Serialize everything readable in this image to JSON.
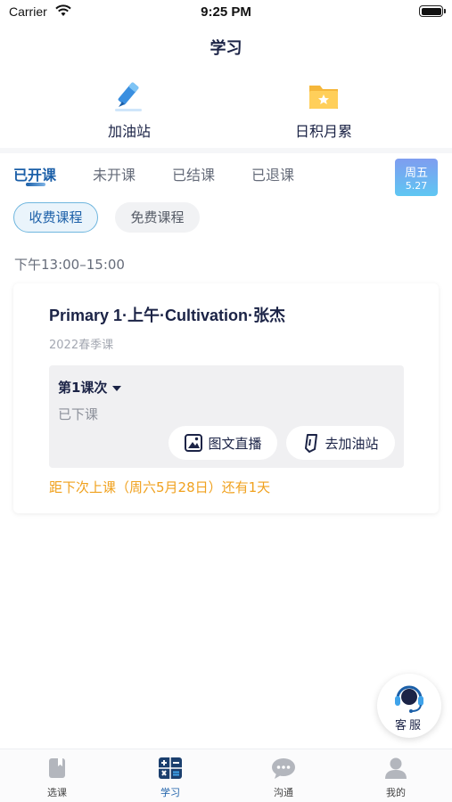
{
  "status_bar": {
    "carrier": "Carrier",
    "time": "9:25 PM"
  },
  "header": {
    "title": "学习"
  },
  "shortcuts": [
    {
      "label": "加油站",
      "icon": "pencil-icon"
    },
    {
      "label": "日积月累",
      "icon": "folder-star-icon"
    }
  ],
  "tabs": [
    {
      "label": "已开课",
      "active": true
    },
    {
      "label": "未开课",
      "active": false
    },
    {
      "label": "已结课",
      "active": false
    },
    {
      "label": "已退课",
      "active": false
    }
  ],
  "date_badge": {
    "weekday": "周五",
    "date": "5.27"
  },
  "filters": [
    {
      "label": "收费课程",
      "selected": true
    },
    {
      "label": "免费课程",
      "selected": false
    }
  ],
  "time_slot": "下午13:00–15:00",
  "course": {
    "title": "Primary 1·上午·Cultivation·张杰",
    "term": "2022春季课",
    "lesson": {
      "name": "第1课次",
      "status": "已下课",
      "live_button": "图文直播",
      "station_button": "去加油站"
    },
    "countdown": "距下次上课（周六5月28日）还有1天"
  },
  "customer_service": {
    "label": "客服"
  },
  "bottom_nav": [
    {
      "label": "选课",
      "icon": "book-icon",
      "active": false
    },
    {
      "label": "学习",
      "icon": "calculator-icon",
      "active": true
    },
    {
      "label": "沟通",
      "icon": "chat-icon",
      "active": false
    },
    {
      "label": "我的",
      "icon": "user-icon",
      "active": false
    }
  ],
  "colors": {
    "accent": "#1b5fa8",
    "highlight": "#f0a11e",
    "text": "#1b2346"
  }
}
